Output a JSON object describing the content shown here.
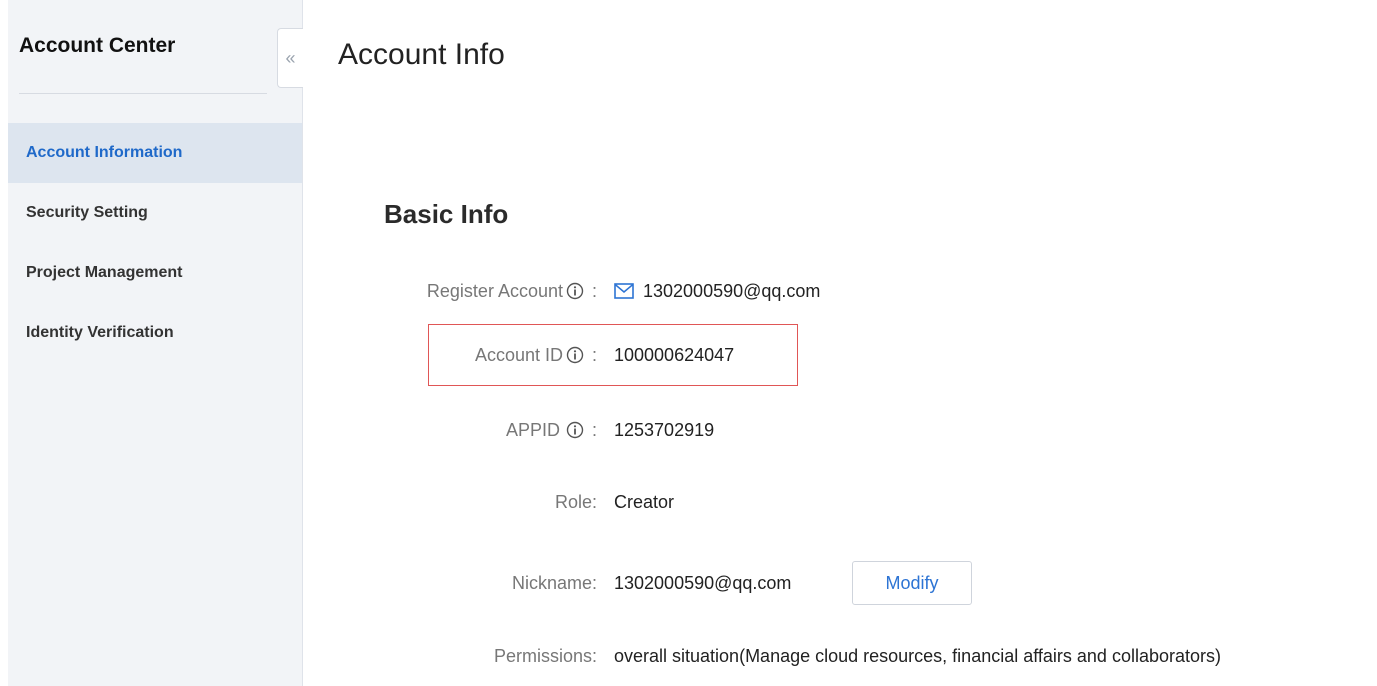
{
  "sidebar": {
    "title": "Account Center",
    "collapse_glyph": "«",
    "items": [
      {
        "label": "Account Information",
        "active": true
      },
      {
        "label": "Security Setting",
        "active": false
      },
      {
        "label": "Project Management",
        "active": false
      },
      {
        "label": "Identity Verification",
        "active": false
      }
    ]
  },
  "main": {
    "title": "Account Info",
    "section_title": "Basic Info",
    "fields": {
      "register_account": {
        "label": "Register Account",
        "separator": " :",
        "value": "1302000590@qq.com"
      },
      "account_id": {
        "label": "Account ID",
        "separator": " :",
        "value": "100000624047"
      },
      "appid": {
        "label": "APPID",
        "separator": " :",
        "value": "1253702919"
      },
      "role": {
        "label": "Role:",
        "value": "Creator"
      },
      "nickname": {
        "label": "Nickname:",
        "value": "1302000590@qq.com"
      },
      "permissions": {
        "label": "Permissions:",
        "value": "overall situation(Manage cloud resources, financial affairs and collaborators)"
      }
    },
    "modify_label": "Modify"
  },
  "colors": {
    "accent": "#1f69c9",
    "highlight_border": "#e05656",
    "sidebar_bg": "#f2f4f7",
    "active_item_bg": "#dde5ef"
  },
  "icons": {
    "info": "info-icon",
    "mail": "mail-icon",
    "collapse": "double-chevron-left-icon"
  }
}
